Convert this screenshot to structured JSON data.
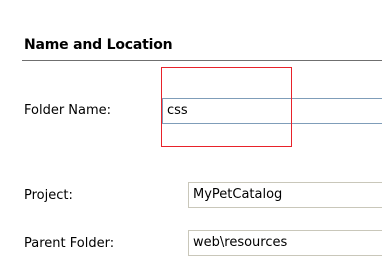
{
  "section": {
    "title": "Name and Location"
  },
  "fields": {
    "folder_name": {
      "label": "Folder Name:",
      "value": "css"
    },
    "project": {
      "label": "Project:",
      "value": "MyPetCatalog"
    },
    "parent_folder": {
      "label": "Parent Folder:",
      "value": "web\\resources"
    }
  },
  "colors": {
    "highlight": "#e8222a",
    "input_border": "#7f9db9",
    "readonly_border": "#c9c7ba",
    "divider": "#6f6f6f"
  }
}
